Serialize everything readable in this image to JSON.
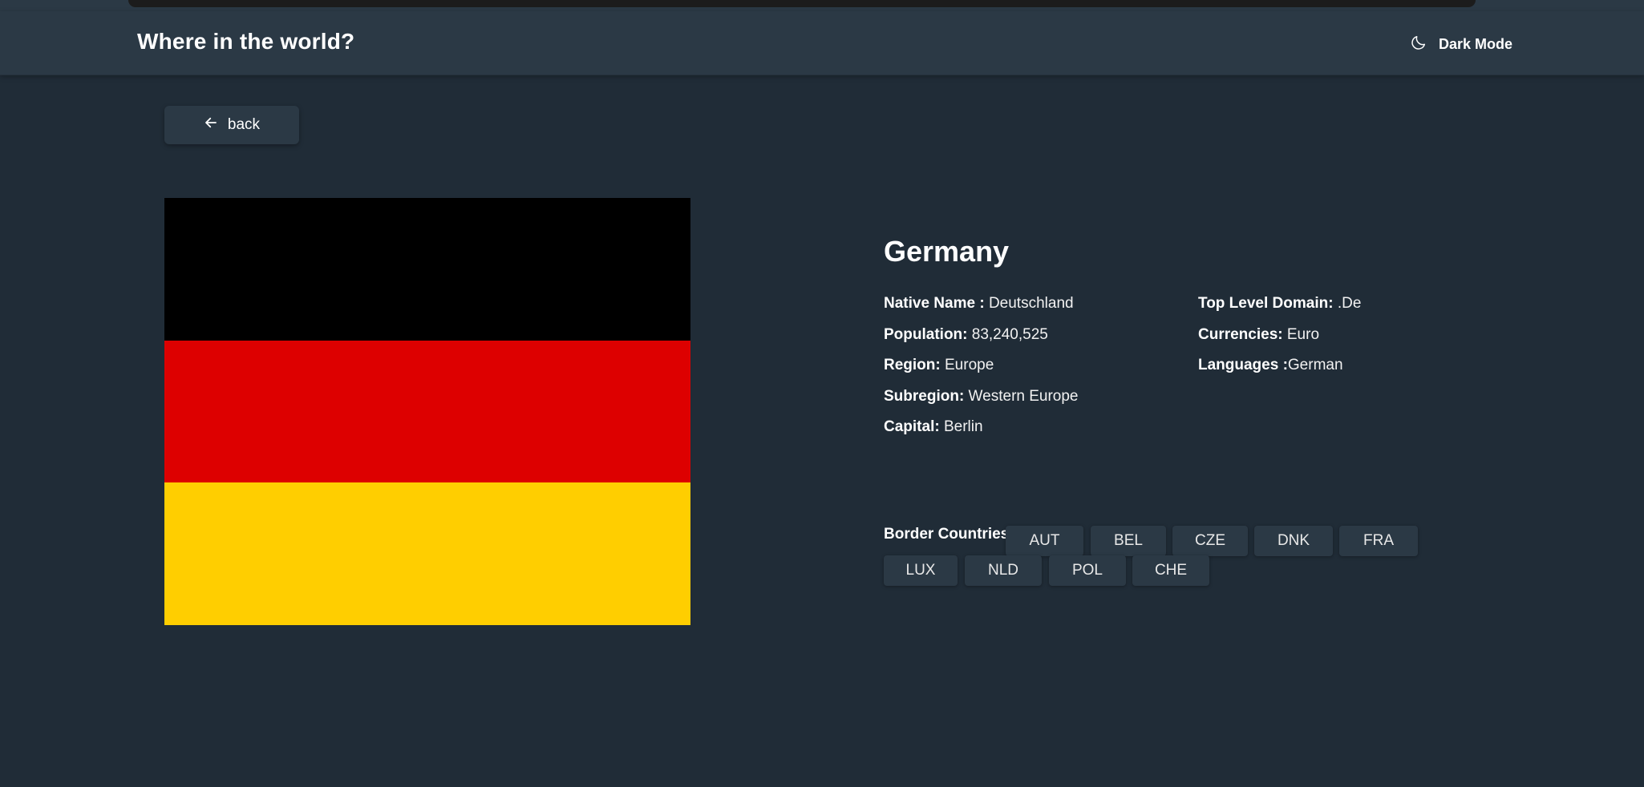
{
  "header": {
    "title": "Where in the world?",
    "theme_toggle": {
      "label": "Dark Mode",
      "icon": "moon-icon"
    }
  },
  "back_button": {
    "label": "back",
    "icon": "arrow-left-icon"
  },
  "flag": {
    "stripes": [
      "#000000",
      "#dd0000",
      "#ffce00"
    ]
  },
  "country": {
    "name": "Germany",
    "left_fields": [
      {
        "key": "Native Name :",
        "value": " Deutschland"
      },
      {
        "key": "Population:",
        "value": " 83,240,525"
      },
      {
        "key": "Region:",
        "value": " Europe"
      },
      {
        "key": "Subregion:",
        "value": " Western Europe"
      },
      {
        "key": "Capital:",
        "value": " Berlin"
      }
    ],
    "right_fields": [
      {
        "key": "Top Level Domain:",
        "value": " .De"
      },
      {
        "key": "Currencies:",
        "value": " Euro"
      },
      {
        "key": "Languages :",
        "value": "German"
      }
    ]
  },
  "borders": {
    "label": "Border Countries:",
    "countries": [
      "AUT",
      "BEL",
      "CZE",
      "DNK",
      "FRA",
      "LUX",
      "NLD",
      "POL",
      "CHE"
    ]
  },
  "colors": {
    "background": "#202c37",
    "element": "#2b3945",
    "text": "#ffffff"
  }
}
